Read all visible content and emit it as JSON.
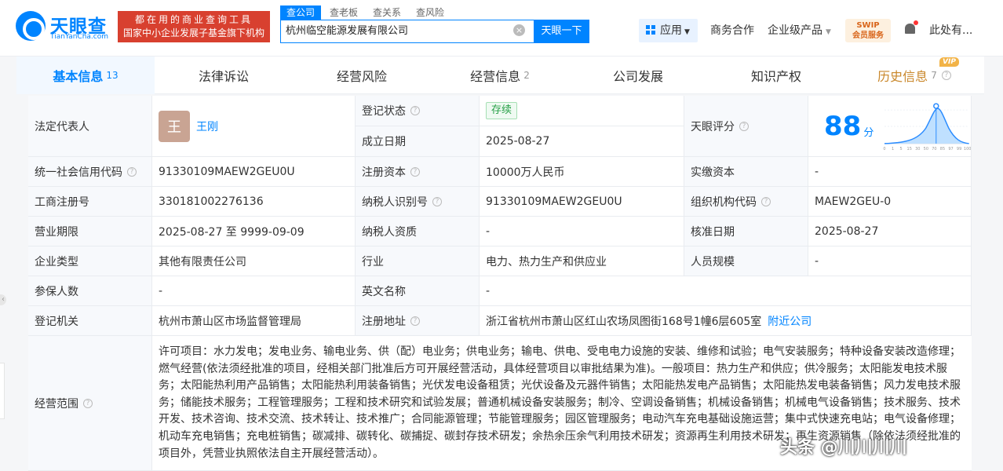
{
  "header": {
    "logo_name": "天眼查",
    "logo_domain": "TianYanCha.com",
    "promo_line1": "都在用的商业查询工具",
    "promo_line2": "国家中小企业发展子基金旗下机构",
    "search_tabs": [
      "查公司",
      "查老板",
      "查关系",
      "查风险"
    ],
    "search_value": "杭州临空能源发展有限公司",
    "search_button": "天眼一下",
    "apps_label": "应用",
    "nav_cooperation": "商务合作",
    "nav_enterprise": "企业级产品",
    "swip_line1": "SWIP",
    "swip_line2": "会员服务",
    "user_name": "此处有..."
  },
  "tabs": [
    {
      "label": "基本信息",
      "count": "13"
    },
    {
      "label": "法律诉讼",
      "count": ""
    },
    {
      "label": "经营风险",
      "count": ""
    },
    {
      "label": "经营信息",
      "count": "2"
    },
    {
      "label": "公司发展",
      "count": ""
    },
    {
      "label": "知识产权",
      "count": ""
    },
    {
      "label": "历史信息",
      "count": "7",
      "badge": "VIP"
    }
  ],
  "info": {
    "legal_rep_label": "法定代表人",
    "legal_rep_avatar": "王",
    "legal_rep_name": "王刚",
    "reg_status_label": "登记状态",
    "reg_status_value": "存续",
    "est_date_label": "成立日期",
    "est_date_value": "2025-08-27",
    "score_label": "天眼评分",
    "score_value": "88",
    "score_unit": "分",
    "score_axis": [
      "0",
      "1",
      "5",
      "15",
      "30",
      "50",
      "70",
      "85",
      "97",
      "99",
      "100"
    ],
    "credit_code_label": "统一社会信用代码",
    "credit_code_value": "91330109MAEW2GEU0U",
    "reg_capital_label": "注册资本",
    "reg_capital_value": "10000万人民币",
    "paid_capital_label": "实缴资本",
    "paid_capital_value": "-",
    "biz_reg_no_label": "工商注册号",
    "biz_reg_no_value": "330181002276136",
    "taxpayer_id_label": "纳税人识别号",
    "taxpayer_id_value": "91330109MAEW2GEU0U",
    "org_code_label": "组织机构代码",
    "org_code_value": "MAEW2GEU-0",
    "term_label": "营业期限",
    "term_value": "2025-08-27 至 9999-09-09",
    "taxpayer_qual_label": "纳税人资质",
    "taxpayer_qual_value": "-",
    "approval_date_label": "核准日期",
    "approval_date_value": "2025-08-27",
    "company_type_label": "企业类型",
    "company_type_value": "其他有限责任公司",
    "industry_label": "行业",
    "industry_value": "电力、热力生产和供应业",
    "staff_size_label": "人员规模",
    "staff_size_value": "-",
    "insured_label": "参保人数",
    "insured_value": "-",
    "english_name_label": "英文名称",
    "english_name_value": "-",
    "authority_label": "登记机关",
    "authority_value": "杭州市萧山区市场监督管理局",
    "address_label": "注册地址",
    "address_value": "浙江省杭州市萧山区红山农场凤图街168号1幢6层605室",
    "nearby_link": "附近公司",
    "scope_label": "经营范围",
    "scope_value": "许可项目：水力发电；发电业务、输电业务、供（配）电业务；供电业务；输电、供电、受电电力设施的安装、维修和试验；电气安装服务；特种设备安装改造修理；燃气经营(依法须经批准的项目，经相关部门批准后方可开展经营活动，具体经营项目以审批结果为准)。一般项目：热力生产和供应；供冷服务；太阳能发电技术服务；太阳能热利用产品销售；太阳能热利用装备销售；光伏发电设备租赁；光伏设备及元器件销售；太阳能热发电产品销售；太阳能热发电装备销售；风力发电技术服务；储能技术服务；工程管理服务；工程和技术研究和试验发展；普通机械设备安装服务；制冷、空调设备销售；机械设备销售；机械电气设备销售；技术服务、技术开发、技术咨询、技术交流、技术转让、技术推广；合同能源管理；节能管理服务；园区管理服务；电动汽车充电基础设施运营；集中式快速充电站；电气设备修理；机动车充电销售；充电桩销售；碳减排、碳转化、碳捕捉、碳封存技术研发；余热余压余气利用技术研发；资源再生利用技术研发；再生资源销售（除依法须经批准的项目外，凭营业执照依法自主开展经营活动）。"
  },
  "watermark": "头条 @川川川川",
  "colors": {
    "brand": "#0084ff",
    "promo": "#d8402f",
    "status_green": "#27a047",
    "history": "#c9872a"
  }
}
